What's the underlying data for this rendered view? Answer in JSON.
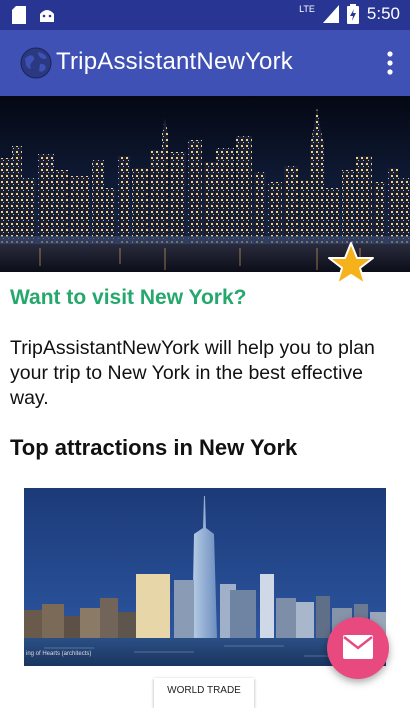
{
  "status_bar": {
    "time": "5:50",
    "network": "LTE",
    "icons": [
      "sd-card-icon",
      "android-icon",
      "signal-icon",
      "battery-icon"
    ]
  },
  "app_bar": {
    "title": "TripAssistantNewYork",
    "icons": [
      "globe-icon",
      "overflow-menu-icon"
    ]
  },
  "content": {
    "headline": "Want to visit New York?",
    "description": "TripAssistantNewYork will help you to plan your trip to New York in the best effective way.",
    "section_title": "Top attractions in New York",
    "photo_credit": "ing of Hearts (architects)",
    "attraction_label": "WORLD TRADE"
  },
  "colors": {
    "status_bar": "#283593",
    "app_bar": "#3f51b5",
    "accent_teal": "#26a86d",
    "fab": "#e84a7f",
    "star": "#f6b21a"
  }
}
